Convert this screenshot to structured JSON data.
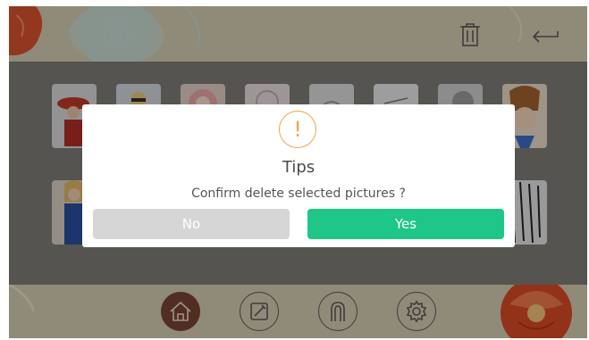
{
  "toolbar": {
    "delete_icon": "trash-icon",
    "back_icon": "back-arrow-icon"
  },
  "gallery": {
    "thumbnails": [
      "red-hat-lady",
      "blonde-girl",
      "flower-wreath",
      "rose-sketch",
      "gray-sketch",
      "leaf-sketch",
      "dark-sketch",
      "anime-boy",
      "dress-girl",
      "sketch-portrait"
    ]
  },
  "dialog": {
    "icon": "exclamation-icon",
    "icon_glyph": "!",
    "title": "Tips",
    "message": "Confirm delete selected pictures ?",
    "no_label": "No",
    "yes_label": "Yes"
  },
  "bottom_nav": {
    "items": [
      "home-icon",
      "draw-icon",
      "finger-icon",
      "settings-icon"
    ]
  },
  "colors": {
    "accent": "#1ec787",
    "warning": "#f1a54c",
    "bar": "#d4ccb2",
    "nav_active": "#7a4333"
  }
}
